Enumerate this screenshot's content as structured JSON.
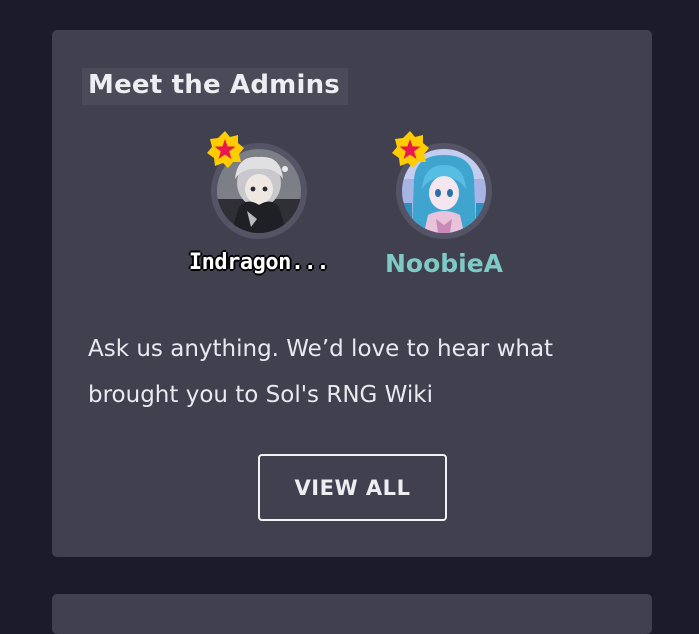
{
  "card": {
    "title": "Meet the Admins",
    "description": "Ask us anything. We’d love to hear what brought you to Sol's RNG Wiki",
    "view_all_label": "VIEW ALL"
  },
  "admins": [
    {
      "name": "Indragon...",
      "avatar_icon": "anime-avatar-grey-hair",
      "badge_icon": "admin-star-badge-icon",
      "name_color": "#ffffff"
    },
    {
      "name": "NoobieA",
      "avatar_icon": "anime-avatar-blue-hair",
      "badge_icon": "admin-star-badge-icon",
      "name_color": "#7ecbc6"
    }
  ],
  "colors": {
    "page_background": "#1c1b2b",
    "card_background": "#41404f",
    "badge_gold": "#ffcc00",
    "badge_star": "#e8174e"
  }
}
